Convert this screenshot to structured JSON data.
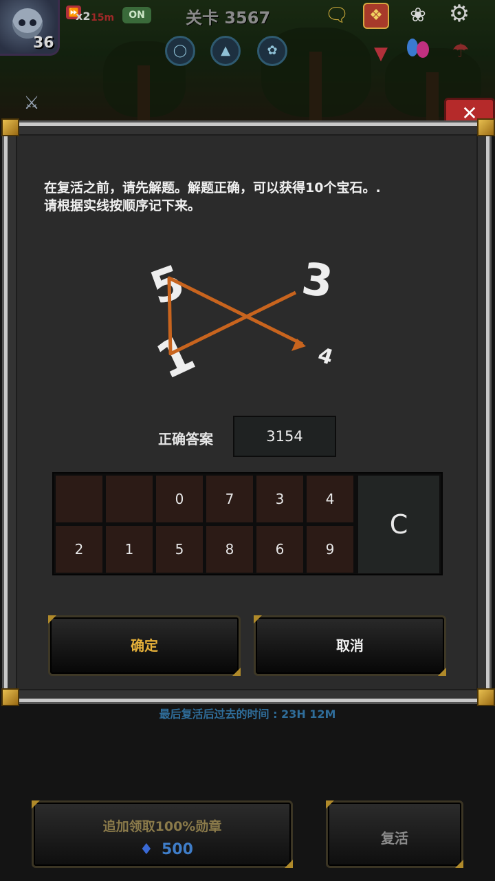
{
  "hud": {
    "level": "36",
    "speed": "x2",
    "speed_sub": "15m",
    "auto_toggle": "ON",
    "stage_title": "关卡 3567"
  },
  "modal": {
    "instruction_line1": "在复活之前，请先解题。解题正确，可以获得10个宝石。.",
    "instruction_line2": "请根据实线按顺序记下来。",
    "puzzle_digits": [
      "5",
      "3",
      "1",
      "4"
    ],
    "answer_label": "正确答案",
    "answer_value": "3154",
    "keypad_row1": [
      "",
      "",
      "0",
      "7",
      "3",
      "4"
    ],
    "keypad_row2": [
      "2",
      "1",
      "5",
      "8",
      "6",
      "9"
    ],
    "clear_label": "C",
    "confirm_label": "确定",
    "cancel_label": "取消"
  },
  "bottom": {
    "timer_text": "最后复活后过去的时间 : 23H 12M",
    "bonus_label": "追加领取100%勋章",
    "gem_count": "500",
    "revive_label": "复活"
  },
  "colors": {
    "accent_gold": "#e8b23a",
    "line_orange": "#c8641e",
    "gem_blue": "#3f7dc8"
  },
  "icons": [
    "skull-avatar-icon",
    "fast-forward-icon",
    "chat-icon",
    "quest-icon",
    "angel-icon",
    "gear-icon",
    "arrow-down-icon",
    "pet-icon",
    "umbrella-icon",
    "sword-icon",
    "close-icon",
    "gem-icon"
  ]
}
